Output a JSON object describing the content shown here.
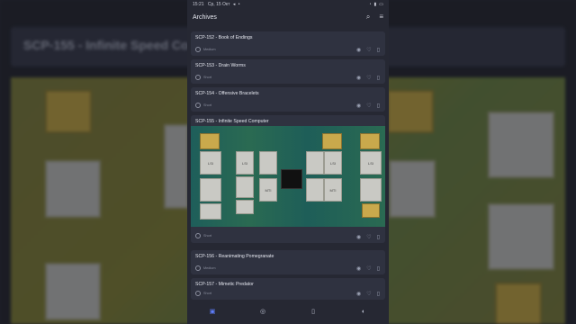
{
  "background": {
    "title": "SCP-155 - Infinite Speed Computer"
  },
  "status_bar": {
    "time": "15:21",
    "date": "Ср, 15 Окт"
  },
  "header": {
    "title": "Archives",
    "search_icon": "search-icon",
    "sort_icon": "sort-icon"
  },
  "items": [
    {
      "title": "SCP-152 - Book of Endings",
      "class": "Medium"
    },
    {
      "title": "SCP-153 - Drain Worms",
      "class": "Short"
    },
    {
      "title": "SCP-154 - Offensive Bracelets",
      "class": "Short"
    },
    {
      "title": "SCP-155 - Infinite Speed Computer",
      "class": "Short"
    },
    {
      "title": "SCP-156 - Reanimating Pomegranate",
      "class": "Medium"
    },
    {
      "title": "SCP-157 - Mimetic Predator",
      "class": "Short"
    }
  ],
  "card_image": {
    "labels": [
      "LSI",
      "MTI"
    ]
  },
  "bottom_nav": {
    "items": [
      "archive-icon",
      "compass-icon",
      "bookmark-icon",
      "random-icon"
    ]
  },
  "colors": {
    "accent": "#5f7fff",
    "card": "#2f3240",
    "background": "#262833"
  }
}
